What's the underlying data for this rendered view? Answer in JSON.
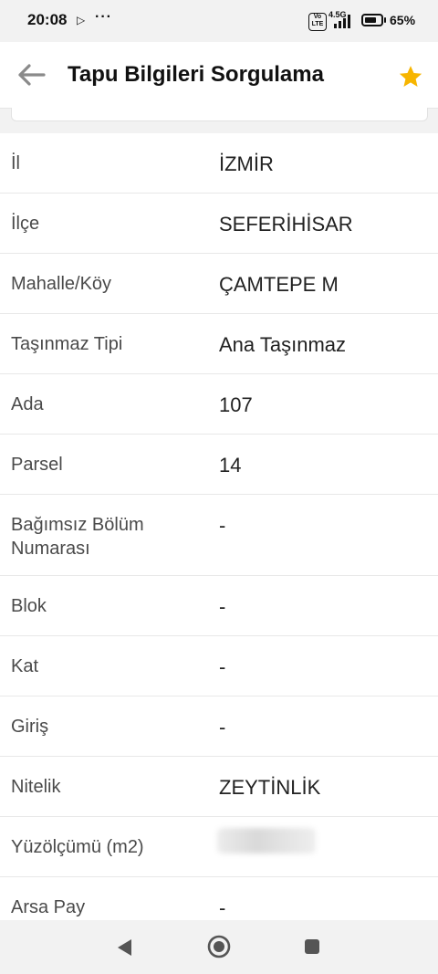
{
  "status": {
    "time": "20:08",
    "cast_icon": "play-cast-icon",
    "more": "···",
    "volte": "Vo LTE",
    "network": "4.5G",
    "battery_percent": "65%"
  },
  "header": {
    "title": "Tapu Bilgileri Sorgulama",
    "back_icon": "arrow-left-icon",
    "favorite_icon": "star-icon",
    "accent_color": "#f7b500"
  },
  "rows": [
    {
      "label": "İl",
      "value": "İZMİR"
    },
    {
      "label": "İlçe",
      "value": "SEFERİHİSAR"
    },
    {
      "label": "Mahalle/Köy",
      "value": "ÇAMTEPE M"
    },
    {
      "label": "Taşınmaz Tipi",
      "value": "Ana Taşınmaz"
    },
    {
      "label": "Ada",
      "value": "107"
    },
    {
      "label": "Parsel",
      "value": "14"
    },
    {
      "label": "Bağımsız Bölüm Numarası",
      "value": "-"
    },
    {
      "label": "Blok",
      "value": "-"
    },
    {
      "label": "Kat",
      "value": "-"
    },
    {
      "label": "Giriş",
      "value": "-"
    },
    {
      "label": "Nitelik",
      "value": "ZEYTİNLİK"
    },
    {
      "label": "Yüzölçümü (m2)",
      "value": ""
    },
    {
      "label": "Arsa Pay",
      "value": "-"
    }
  ],
  "nav": {
    "back_icon": "triangle-back-icon",
    "home_icon": "home-circle-icon",
    "recents_icon": "square-recents-icon"
  }
}
